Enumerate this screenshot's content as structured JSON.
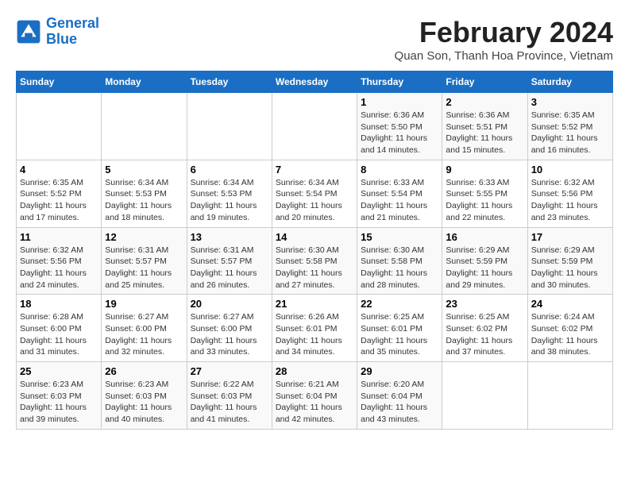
{
  "logo": {
    "line1": "General",
    "line2": "Blue"
  },
  "title": "February 2024",
  "subtitle": "Quan Son, Thanh Hoa Province, Vietnam",
  "headers": [
    "Sunday",
    "Monday",
    "Tuesday",
    "Wednesday",
    "Thursday",
    "Friday",
    "Saturday"
  ],
  "weeks": [
    [
      {
        "day": "",
        "info": ""
      },
      {
        "day": "",
        "info": ""
      },
      {
        "day": "",
        "info": ""
      },
      {
        "day": "",
        "info": ""
      },
      {
        "day": "1",
        "info": "Sunrise: 6:36 AM\nSunset: 5:50 PM\nDaylight: 11 hours\nand 14 minutes."
      },
      {
        "day": "2",
        "info": "Sunrise: 6:36 AM\nSunset: 5:51 PM\nDaylight: 11 hours\nand 15 minutes."
      },
      {
        "day": "3",
        "info": "Sunrise: 6:35 AM\nSunset: 5:52 PM\nDaylight: 11 hours\nand 16 minutes."
      }
    ],
    [
      {
        "day": "4",
        "info": "Sunrise: 6:35 AM\nSunset: 5:52 PM\nDaylight: 11 hours\nand 17 minutes."
      },
      {
        "day": "5",
        "info": "Sunrise: 6:34 AM\nSunset: 5:53 PM\nDaylight: 11 hours\nand 18 minutes."
      },
      {
        "day": "6",
        "info": "Sunrise: 6:34 AM\nSunset: 5:53 PM\nDaylight: 11 hours\nand 19 minutes."
      },
      {
        "day": "7",
        "info": "Sunrise: 6:34 AM\nSunset: 5:54 PM\nDaylight: 11 hours\nand 20 minutes."
      },
      {
        "day": "8",
        "info": "Sunrise: 6:33 AM\nSunset: 5:54 PM\nDaylight: 11 hours\nand 21 minutes."
      },
      {
        "day": "9",
        "info": "Sunrise: 6:33 AM\nSunset: 5:55 PM\nDaylight: 11 hours\nand 22 minutes."
      },
      {
        "day": "10",
        "info": "Sunrise: 6:32 AM\nSunset: 5:56 PM\nDaylight: 11 hours\nand 23 minutes."
      }
    ],
    [
      {
        "day": "11",
        "info": "Sunrise: 6:32 AM\nSunset: 5:56 PM\nDaylight: 11 hours\nand 24 minutes."
      },
      {
        "day": "12",
        "info": "Sunrise: 6:31 AM\nSunset: 5:57 PM\nDaylight: 11 hours\nand 25 minutes."
      },
      {
        "day": "13",
        "info": "Sunrise: 6:31 AM\nSunset: 5:57 PM\nDaylight: 11 hours\nand 26 minutes."
      },
      {
        "day": "14",
        "info": "Sunrise: 6:30 AM\nSunset: 5:58 PM\nDaylight: 11 hours\nand 27 minutes."
      },
      {
        "day": "15",
        "info": "Sunrise: 6:30 AM\nSunset: 5:58 PM\nDaylight: 11 hours\nand 28 minutes."
      },
      {
        "day": "16",
        "info": "Sunrise: 6:29 AM\nSunset: 5:59 PM\nDaylight: 11 hours\nand 29 minutes."
      },
      {
        "day": "17",
        "info": "Sunrise: 6:29 AM\nSunset: 5:59 PM\nDaylight: 11 hours\nand 30 minutes."
      }
    ],
    [
      {
        "day": "18",
        "info": "Sunrise: 6:28 AM\nSunset: 6:00 PM\nDaylight: 11 hours\nand 31 minutes."
      },
      {
        "day": "19",
        "info": "Sunrise: 6:27 AM\nSunset: 6:00 PM\nDaylight: 11 hours\nand 32 minutes."
      },
      {
        "day": "20",
        "info": "Sunrise: 6:27 AM\nSunset: 6:00 PM\nDaylight: 11 hours\nand 33 minutes."
      },
      {
        "day": "21",
        "info": "Sunrise: 6:26 AM\nSunset: 6:01 PM\nDaylight: 11 hours\nand 34 minutes."
      },
      {
        "day": "22",
        "info": "Sunrise: 6:25 AM\nSunset: 6:01 PM\nDaylight: 11 hours\nand 35 minutes."
      },
      {
        "day": "23",
        "info": "Sunrise: 6:25 AM\nSunset: 6:02 PM\nDaylight: 11 hours\nand 37 minutes."
      },
      {
        "day": "24",
        "info": "Sunrise: 6:24 AM\nSunset: 6:02 PM\nDaylight: 11 hours\nand 38 minutes."
      }
    ],
    [
      {
        "day": "25",
        "info": "Sunrise: 6:23 AM\nSunset: 6:03 PM\nDaylight: 11 hours\nand 39 minutes."
      },
      {
        "day": "26",
        "info": "Sunrise: 6:23 AM\nSunset: 6:03 PM\nDaylight: 11 hours\nand 40 minutes."
      },
      {
        "day": "27",
        "info": "Sunrise: 6:22 AM\nSunset: 6:03 PM\nDaylight: 11 hours\nand 41 minutes."
      },
      {
        "day": "28",
        "info": "Sunrise: 6:21 AM\nSunset: 6:04 PM\nDaylight: 11 hours\nand 42 minutes."
      },
      {
        "day": "29",
        "info": "Sunrise: 6:20 AM\nSunset: 6:04 PM\nDaylight: 11 hours\nand 43 minutes."
      },
      {
        "day": "",
        "info": ""
      },
      {
        "day": "",
        "info": ""
      }
    ]
  ]
}
